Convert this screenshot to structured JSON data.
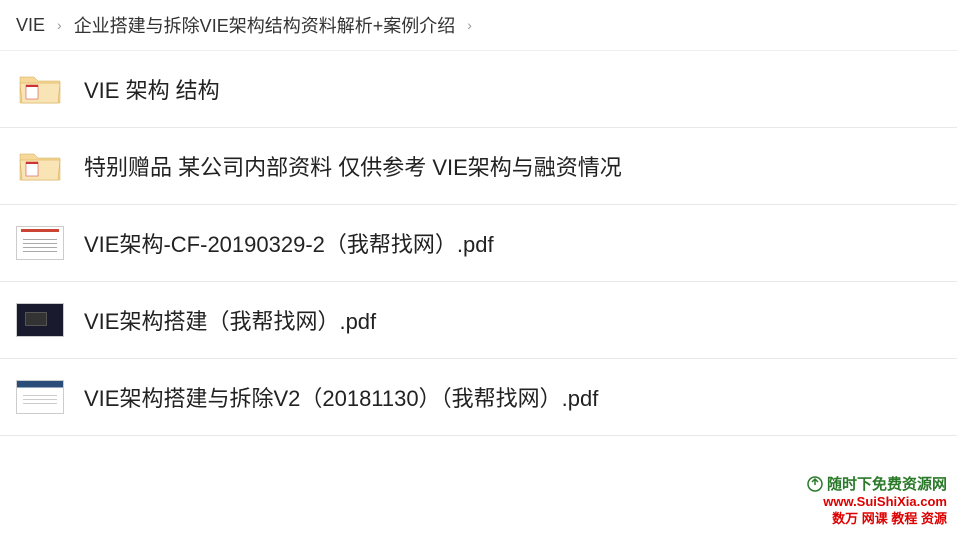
{
  "breadcrumb": {
    "items": [
      "VIE",
      "企业搭建与拆除VIE架构结构资料解析+案例介绍"
    ]
  },
  "files": [
    {
      "type": "folder",
      "name": "VIE 架构 结构"
    },
    {
      "type": "folder",
      "name": "特别赠品 某公司内部资料 仅供参考 VIE架构与融资情况"
    },
    {
      "type": "pdf",
      "variant": "white",
      "name": "VIE架构-CF-20190329-2（我帮找网）.pdf"
    },
    {
      "type": "pdf",
      "variant": "dark",
      "name": "VIE架构搭建（我帮找网）.pdf"
    },
    {
      "type": "pdf",
      "variant": "blue",
      "name": "VIE架构搭建与拆除V2（20181130）（我帮找网）.pdf"
    }
  ],
  "watermark": {
    "title": "随时下免费资源网",
    "url": "www.SuiShiXia.com",
    "sub": "数万 网课 教程 资源"
  }
}
